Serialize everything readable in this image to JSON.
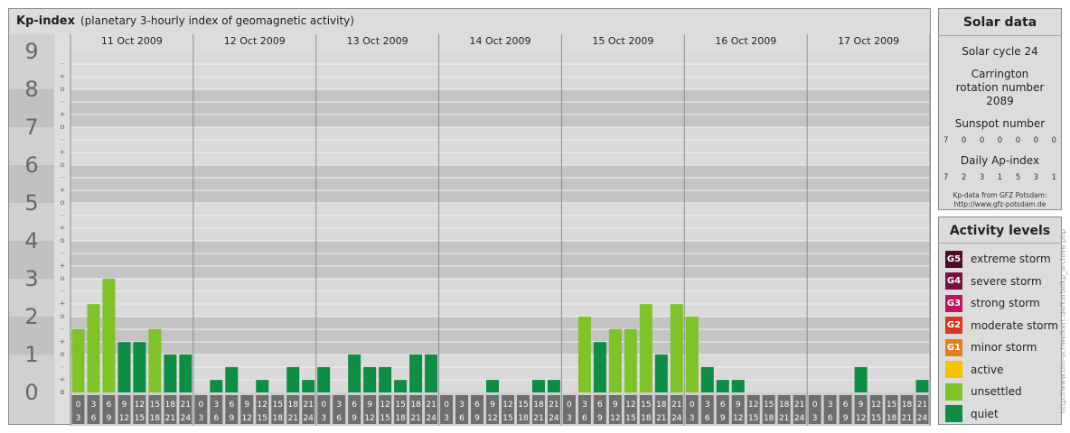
{
  "header": {
    "title": "Kp-index",
    "subtitle": "(planetary 3-hourly index of geomagnetic activity)"
  },
  "chart_data": {
    "type": "bar",
    "title": "Kp-index",
    "subtitle": "(planetary 3-hourly index of geomagnetic activity)",
    "days": [
      "11 Oct 2009",
      "12 Oct 2009",
      "13 Oct 2009",
      "14 Oct 2009",
      "15 Oct 2009",
      "16 Oct 2009",
      "17 Oct 2009"
    ],
    "interval_start_hours": [
      "0",
      "3",
      "6",
      "9",
      "12",
      "15",
      "18",
      "21"
    ],
    "interval_end_hours": [
      "3",
      "6",
      "9",
      "12",
      "15",
      "18",
      "21",
      "24"
    ],
    "ylim": [
      0,
      9
    ],
    "y_major_ticks": [
      "0",
      "1",
      "2",
      "3",
      "4",
      "5",
      "6",
      "7",
      "8",
      "9"
    ],
    "y_minor_ticks": [
      "o",
      "+",
      "-",
      "o",
      "+",
      "-"
    ],
    "values": [
      [
        1.67,
        2.33,
        3.0,
        1.33,
        1.33,
        1.67,
        1.0,
        1.0
      ],
      [
        0.0,
        0.33,
        0.67,
        0.0,
        0.33,
        0.0,
        0.67,
        0.33
      ],
      [
        0.67,
        0.0,
        1.0,
        0.67,
        0.67,
        0.33,
        1.0,
        1.0
      ],
      [
        0.0,
        0.0,
        0.0,
        0.33,
        0.0,
        0.0,
        0.33,
        0.33
      ],
      [
        0.0,
        2.0,
        1.33,
        1.67,
        1.67,
        2.33,
        1.0,
        2.33
      ],
      [
        2.0,
        0.67,
        0.33,
        0.33,
        0.0,
        0.0,
        0.0,
        0.0
      ],
      [
        0.0,
        0.0,
        0.0,
        0.67,
        0.0,
        0.0,
        0.0,
        0.33
      ]
    ],
    "colors": {
      "quiet": "#0f8d45",
      "unsettled": "#7fc22a",
      "active": "#f5c400"
    },
    "grid": true,
    "legend": "right"
  },
  "solar": {
    "title": "Solar data",
    "cycle": "Solar cycle 24",
    "carrington": "Carrington rotation number 2089",
    "sunspot_label": "Sunspot number",
    "sunspot_values": [
      "7",
      "0",
      "0",
      "0",
      "0",
      "0",
      "0"
    ],
    "ap_label": "Daily Ap-index",
    "ap_values": [
      "7",
      "2",
      "3",
      "1",
      "5",
      "3",
      "1"
    ],
    "credit_line1": "Kp-data from GFZ Potsdam:",
    "credit_line2": "http://www.gfz-potsdam.de"
  },
  "activity": {
    "title": "Activity levels",
    "items": [
      {
        "badge": "G5",
        "label": "extreme storm",
        "color": "#4d0d2a"
      },
      {
        "badge": "G4",
        "label": "severe storm",
        "color": "#7b1040"
      },
      {
        "badge": "G3",
        "label": "strong storm",
        "color": "#c2135f"
      },
      {
        "badge": "G2",
        "label": "moderate storm",
        "color": "#d9381e"
      },
      {
        "badge": "G1",
        "label": "minor storm",
        "color": "#e3801e"
      },
      {
        "badge": "",
        "label": "active",
        "color": "#f5c400"
      },
      {
        "badge": "",
        "label": "unsettled",
        "color": "#7fc22a"
      },
      {
        "badge": "",
        "label": "quiet",
        "color": "#0f8d45"
      }
    ]
  },
  "side_note": "http://www.tim-schweikert.de/karte/kp_archive.php"
}
